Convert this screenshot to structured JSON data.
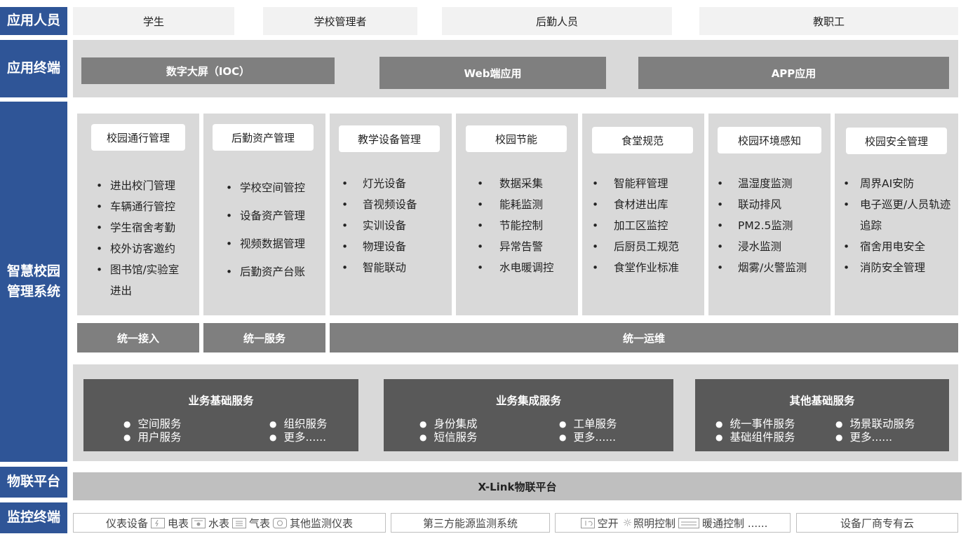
{
  "row_labels": {
    "users": "应用人员",
    "terminals": "应用终端",
    "system": "智慧校园管理系统",
    "iot": "物联平台",
    "monitor": "监控终端"
  },
  "users": [
    "学生",
    "学校管理者",
    "后勤人员",
    "教职工"
  ],
  "terminals": [
    "数字大屏（IOC）",
    "Web端应用",
    "APP应用"
  ],
  "modules": [
    {
      "title": "校园通行管理",
      "items": [
        "进出校门管理",
        "车辆通行管控",
        "学生宿舍考勤",
        "校外访客邀约",
        "图书馆/实验室进出"
      ]
    },
    {
      "title": "后勤资产管理",
      "items": [
        "学校空间管控",
        "设备资产管理",
        "视频数据管理",
        "后勤资产台账"
      ]
    },
    {
      "title": "教学设备管理",
      "items": [
        "灯光设备",
        "音视频设备",
        "实训设备",
        "物理设备",
        "智能联动"
      ]
    },
    {
      "title": "校园节能",
      "items": [
        "数据采集",
        "能耗监测",
        "节能控制",
        "异常告警",
        "水电暖调控"
      ]
    },
    {
      "title": "食堂规范",
      "items": [
        "智能秤管理",
        "食材进出库",
        "加工区监控",
        "后厨员工规范",
        "食堂作业标准"
      ]
    },
    {
      "title": "校园环境感知",
      "items": [
        "温湿度监测",
        "联动排风",
        "PM2.5监测",
        "浸水监测",
        "烟雾/火警监测"
      ]
    },
    {
      "title": "校园安全管理",
      "items": [
        "周界AI安防",
        "电子巡更/人员轨迹追踪",
        "宿舍用电安全",
        "消防安全管理"
      ]
    }
  ],
  "unified": [
    "统一接入",
    "统一服务",
    "统一运维"
  ],
  "services": [
    {
      "title": "业务基础服务",
      "items": [
        "空间服务",
        "组织服务",
        "用户服务",
        "更多......"
      ]
    },
    {
      "title": "业务集成服务",
      "items": [
        "身份集成",
        "工单服务",
        "短信服务",
        "更多......"
      ]
    },
    {
      "title": "其他基础服务",
      "items": [
        "统一事件服务",
        "场景联动服务",
        "基础组件服务",
        "更多......"
      ]
    }
  ],
  "iot_platform": "X-Link物联平台",
  "monitor": {
    "meters": {
      "lead": "仪表设备",
      "items": [
        {
          "label": "电表",
          "icon": "electric-meter-icon"
        },
        {
          "label": "水表",
          "icon": "water-meter-icon"
        },
        {
          "label": "气表",
          "icon": "gas-meter-icon"
        },
        {
          "label": "其他监测仪表",
          "icon": "other-meter-icon"
        }
      ]
    },
    "third_party": "第三方能源监测系统",
    "controls": {
      "items": [
        {
          "label": "空开",
          "icon": "breaker-icon"
        },
        {
          "label": "照明控制",
          "icon": "light-icon"
        },
        {
          "label": "暖通控制 ......",
          "icon": "hvac-icon"
        }
      ]
    },
    "vendor_cloud": "设备厂商专有云"
  },
  "colors": {
    "label_blue": "#2f5597",
    "band_grey": "#d9d9d9",
    "bar_grey": "#7f7f7f",
    "service_dark": "#595959"
  }
}
